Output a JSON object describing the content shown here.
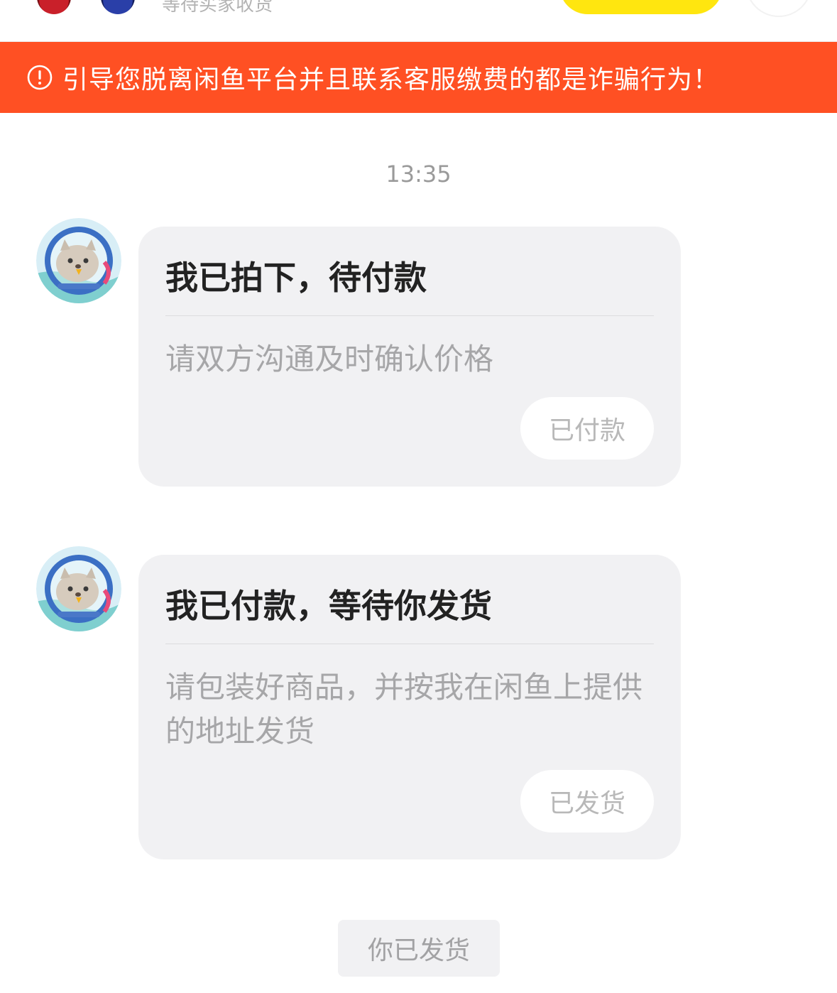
{
  "header": {
    "status_text": "等待买家收货",
    "avatar_left_icon": "buyer-avatar-icon",
    "avatar_right_icon": "seller-avatar-icon",
    "accent_color": "#ffe60f"
  },
  "warning": {
    "icon": "exclamation-circle-icon",
    "text": "引导您脱离闲鱼平台并且联系客服缴费的都是诈骗行为！",
    "background_color": "#ff5023"
  },
  "chat": {
    "timestamp": "13:35",
    "messages": [
      {
        "avatar_icon": "seal-astronaut-avatar-icon",
        "title": "我已拍下，待付款",
        "description": "请双方沟通及时确认价格",
        "action_label": "已付款"
      },
      {
        "avatar_icon": "seal-astronaut-avatar-icon",
        "title": "我已付款，等待你发货",
        "description": "请包装好商品，并按我在闲鱼上提供的地址发货",
        "action_label": "已发货"
      }
    ],
    "system_notice": "你已发货"
  }
}
